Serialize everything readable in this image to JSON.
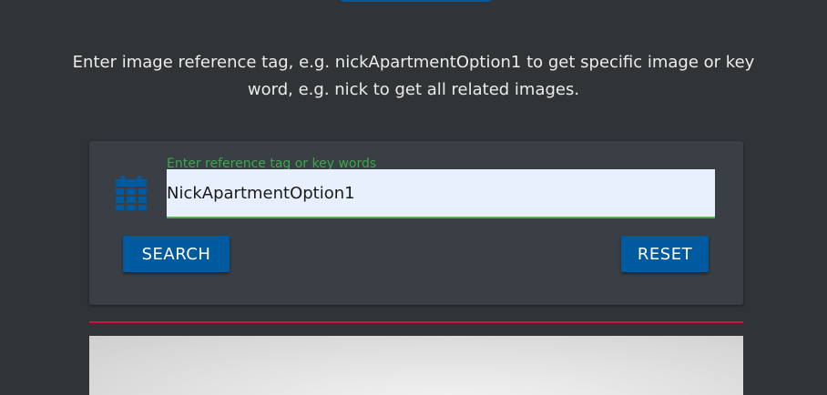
{
  "intro": {
    "text": "Enter image reference tag, e.g. nickApartmentOption1 to get specific image or key word, e.g. nick to get all related images."
  },
  "search_form": {
    "icon": "calendar-icon",
    "label": "Enter reference tag or key words",
    "value": "NickApartmentOption1",
    "search_label": "SEARCH",
    "reset_label": "RESET"
  },
  "colors": {
    "background": "#303436",
    "card": "#3a3f45",
    "accent": "#005aa0",
    "label_green": "#3ca84b",
    "divider": "#c8163a"
  }
}
